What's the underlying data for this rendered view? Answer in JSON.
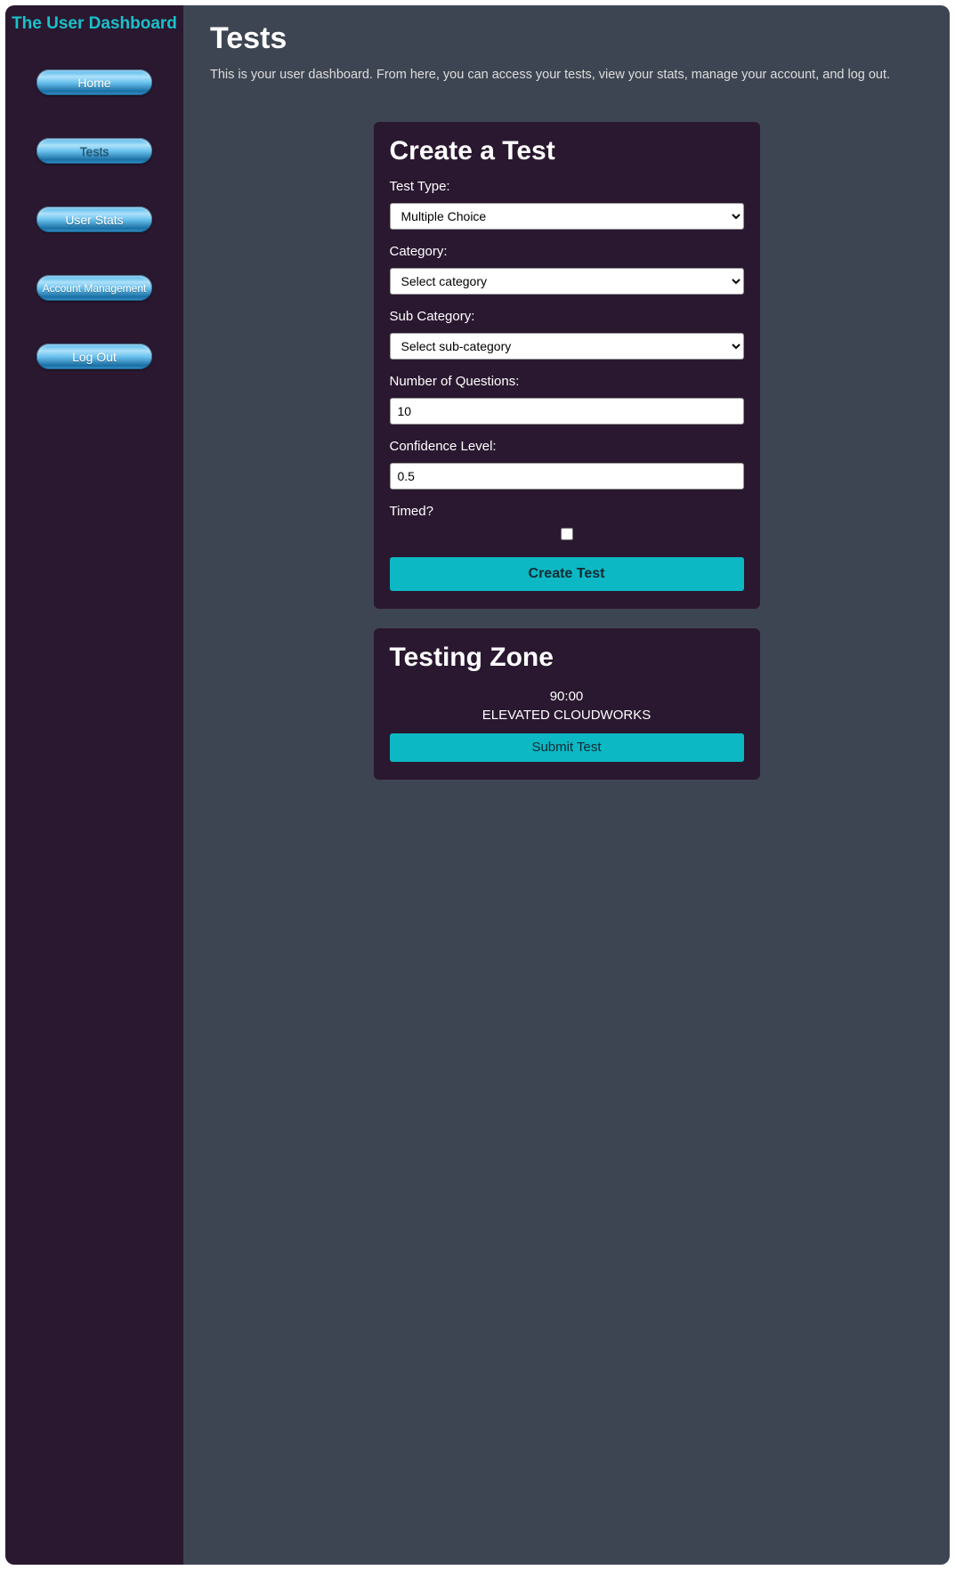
{
  "sidebar": {
    "title": "The User Dashboard",
    "items": [
      {
        "label": "Home"
      },
      {
        "label": "Tests"
      },
      {
        "label": "User Stats"
      },
      {
        "label": "Account Management"
      },
      {
        "label": "Log Out"
      }
    ]
  },
  "page": {
    "title": "Tests",
    "description": "This is your user dashboard. From here, you can access your tests, view your stats, manage your account, and log out."
  },
  "createTest": {
    "title": "Create a Test",
    "labels": {
      "testType": "Test Type:",
      "category": "Category:",
      "subCategory": "Sub Category:",
      "numQuestions": "Number of Questions:",
      "confidence": "Confidence Level:",
      "timed": "Timed?"
    },
    "values": {
      "testType": "Multiple Choice",
      "category": "Select category",
      "subCategory": "Select sub-category",
      "numQuestions": "10",
      "confidence": "0.5"
    },
    "submitLabel": "Create Test"
  },
  "testingZone": {
    "title": "Testing Zone",
    "timer": "90:00",
    "term": "ELEVATED CLOUDWORKS",
    "submitLabel": "Submit Test"
  }
}
